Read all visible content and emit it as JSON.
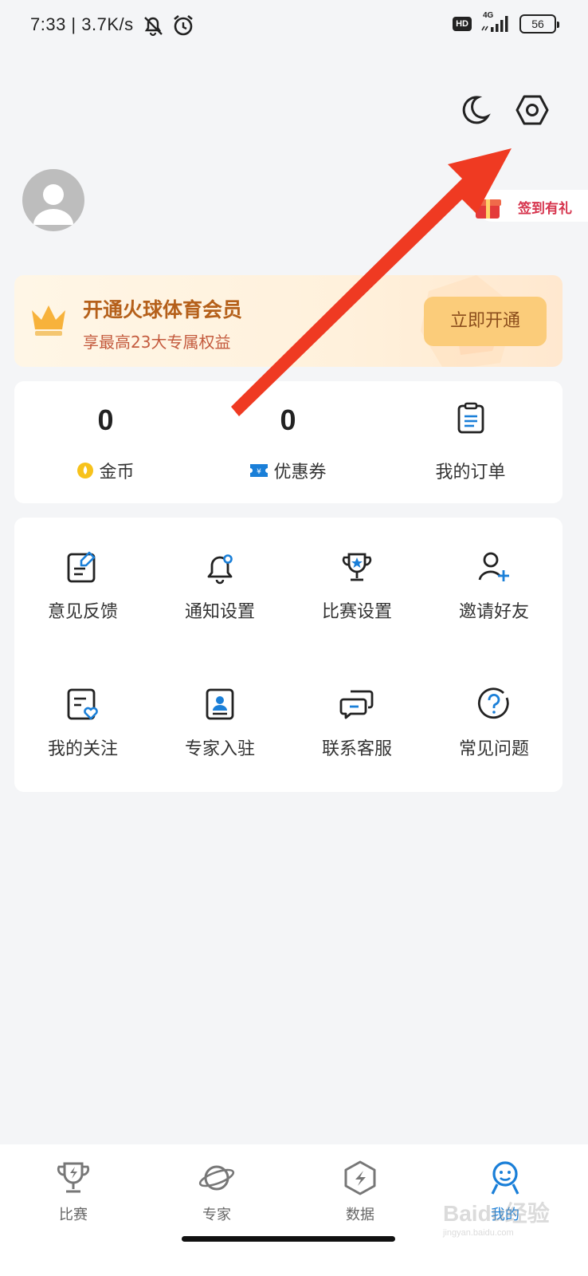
{
  "status_bar": {
    "time_speed": "7:33 | 3.7K/s",
    "network": "4G",
    "hd": "HD",
    "battery": "56"
  },
  "header": {
    "checkin_label": "签到有礼"
  },
  "vip_card": {
    "title": "开通火球体育会员",
    "subtitle": "享最高23大专属权益",
    "button": "立即开通"
  },
  "stats": [
    {
      "value": "0",
      "label": "金币",
      "icon": "coin-icon"
    },
    {
      "value": "0",
      "label": "优惠券",
      "icon": "coupon-icon"
    },
    {
      "label": "我的订单",
      "icon": "order-icon"
    }
  ],
  "grid": [
    {
      "label": "意见反馈",
      "icon": "feedback-icon"
    },
    {
      "label": "通知设置",
      "icon": "bell-icon"
    },
    {
      "label": "比赛设置",
      "icon": "trophy-icon"
    },
    {
      "label": "邀请好友",
      "icon": "add-user-icon"
    },
    {
      "label": "我的关注",
      "icon": "favorite-list-icon"
    },
    {
      "label": "专家入驻",
      "icon": "expert-badge-icon"
    },
    {
      "label": "联系客服",
      "icon": "chat-icon"
    },
    {
      "label": "常见问题",
      "icon": "help-icon"
    }
  ],
  "tabs": [
    {
      "label": "比赛",
      "icon": "trophy-tab-icon",
      "active": false
    },
    {
      "label": "专家",
      "icon": "planet-tab-icon",
      "active": false
    },
    {
      "label": "数据",
      "icon": "data-tab-icon",
      "active": false
    },
    {
      "label": "我的",
      "icon": "profile-tab-icon",
      "active": true
    }
  ],
  "watermark": {
    "brand": "Baidu经验",
    "url": "jingyan.baidu.com"
  },
  "colors": {
    "accent_blue": "#1a7fd8",
    "annotation_red": "#ef3a22",
    "vip_gold": "#b5601a",
    "checkin_red": "#d6344d"
  }
}
